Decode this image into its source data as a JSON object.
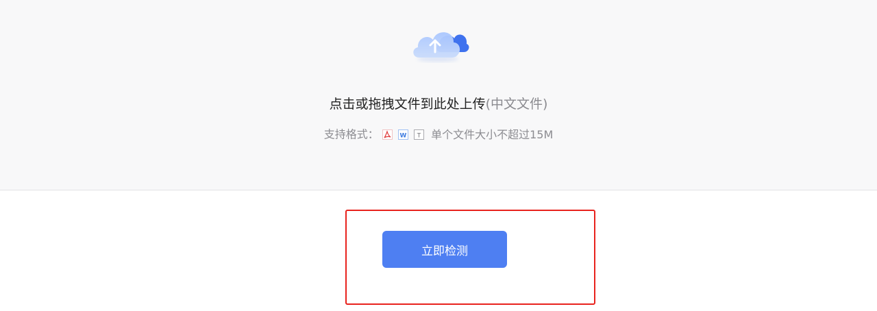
{
  "upload": {
    "title_main": "点击或拖拽文件到此处上传",
    "title_hint": "(中文文件)",
    "formats_label": "支持格式：",
    "format_icons": [
      "pdf-icon",
      "word-icon",
      "txt-icon"
    ],
    "format_icon_letters": {
      "word": "W",
      "txt": "T"
    },
    "size_note": "单个文件大小不超过15M",
    "cloud_icon": "cloud-upload-icon"
  },
  "actions": {
    "detect_label": "立即检测"
  },
  "colors": {
    "accent": "#4e7ff2",
    "highlight": "#e8211c",
    "zone_bg": "#f8f8f9"
  }
}
